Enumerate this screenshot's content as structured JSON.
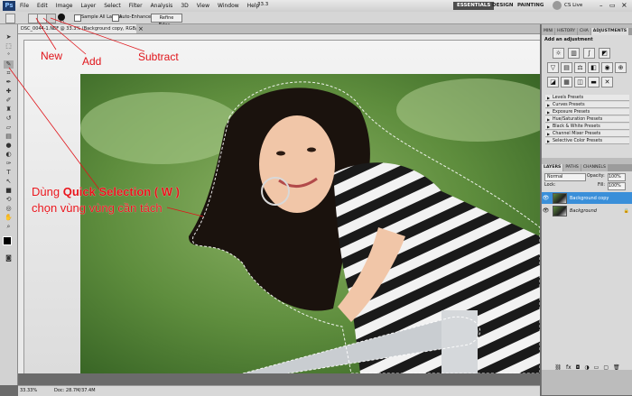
{
  "menubar": {
    "logo": "Ps",
    "items": [
      "File",
      "Edit",
      "Image",
      "Layer",
      "Select",
      "Filter",
      "Analysis",
      "3D",
      "View",
      "Window",
      "Help"
    ],
    "zoom": "33.3",
    "workspaces": [
      "ESSENTIALS",
      "DESIGN",
      "PAINTING"
    ],
    "cslive": "CS Live"
  },
  "options": {
    "sample_all_layers": "Sample All Layers",
    "auto_enhance": "Auto-Enhance",
    "refine_edge": "Refine Edge...",
    "brush_size": "15"
  },
  "document": {
    "tab_title": "DSC_0044-1.NEF @ 33.3% (Background copy, RGB/8*) *"
  },
  "annotations": {
    "new": "New",
    "add": "Add",
    "subtract": "Subtract",
    "line1_prefix": "Dùng ",
    "line1_bold": "Quick Selection ( W )",
    "line2": "chọn vùng vùng cần tách"
  },
  "status": {
    "zoom": "33.33%",
    "doc": "Doc: 28.7M/37.4M"
  },
  "adjustments": {
    "tabs": [
      "MINI",
      "HISTORY",
      "CHA",
      "ADJUSTMENTS"
    ],
    "title": "Add an adjustment",
    "presets": [
      "Levels Presets",
      "Curves Presets",
      "Exposure Presets",
      "Hue/Saturation Presets",
      "Black & White Presets",
      "Channel Mixer Presets",
      "Selective Color Presets"
    ]
  },
  "layers": {
    "tabs": [
      "LAYERS",
      "PATHS",
      "CHANNELS"
    ],
    "blend_mode": "Normal",
    "opacity_label": "Opacity:",
    "opacity": "100%",
    "lock_label": "Lock:",
    "fill_label": "Fill:",
    "fill": "100%",
    "rows": [
      {
        "name": "Background copy",
        "selected": true
      },
      {
        "name": "Background",
        "selected": false
      }
    ]
  },
  "colors": {
    "annotation": "#e0141a",
    "selection_highlight": "#3a8fd9"
  }
}
